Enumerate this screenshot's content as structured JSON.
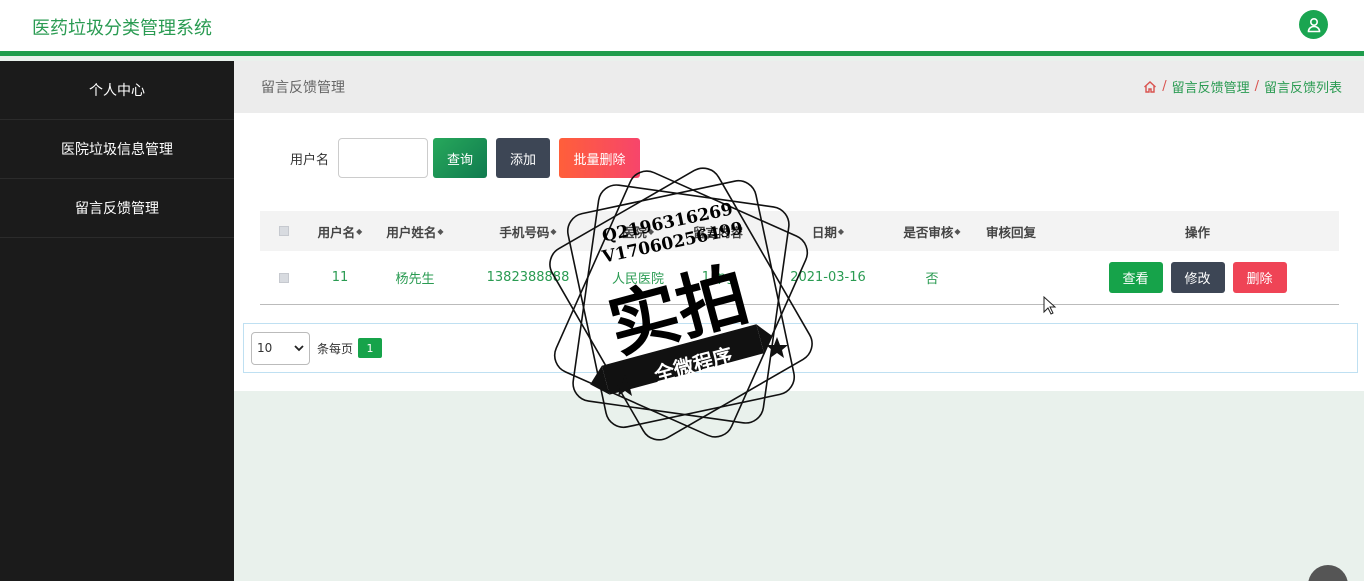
{
  "header": {
    "title": "医药垃圾分类管理系统"
  },
  "sidebar": {
    "items": [
      {
        "label": "个人中心"
      },
      {
        "label": "医院垃圾信息管理"
      },
      {
        "label": "留言反馈管理"
      }
    ]
  },
  "breadcrumb": {
    "page_title": "留言反馈管理",
    "trail": [
      "留言反馈管理",
      "留言反馈列表"
    ],
    "separator": "/"
  },
  "search": {
    "label": "用户名",
    "value": "",
    "query_label": "查询",
    "add_label": "添加",
    "batch_delete_label": "批量删除"
  },
  "table": {
    "columns": [
      "用户名",
      "用户姓名",
      "手机号码",
      "医院",
      "留言内容",
      "日期",
      "是否审核",
      "审核回复",
      "操作"
    ],
    "rows": [
      {
        "username": "11",
        "name": "杨先生",
        "phone": "1382388888",
        "hospital": "人民医院",
        "content": "1.jpg",
        "date": "2021-03-16",
        "audited": "否",
        "reply": ""
      }
    ],
    "actions": {
      "view": "查看",
      "edit": "修改",
      "delete": "删除"
    }
  },
  "pagination": {
    "page_size": "10",
    "per_page_label": "条每页",
    "current_page": "1"
  },
  "watermark": {
    "line1": "Q2196316269",
    "line2": "V17060256499",
    "main": "实拍",
    "ribbon": "全微程序"
  },
  "colors": {
    "accent": "#1f9d4c",
    "sidebar_bg": "#1b1b1b",
    "danger": "#ef4456",
    "dark_btn": "#3d4655"
  }
}
